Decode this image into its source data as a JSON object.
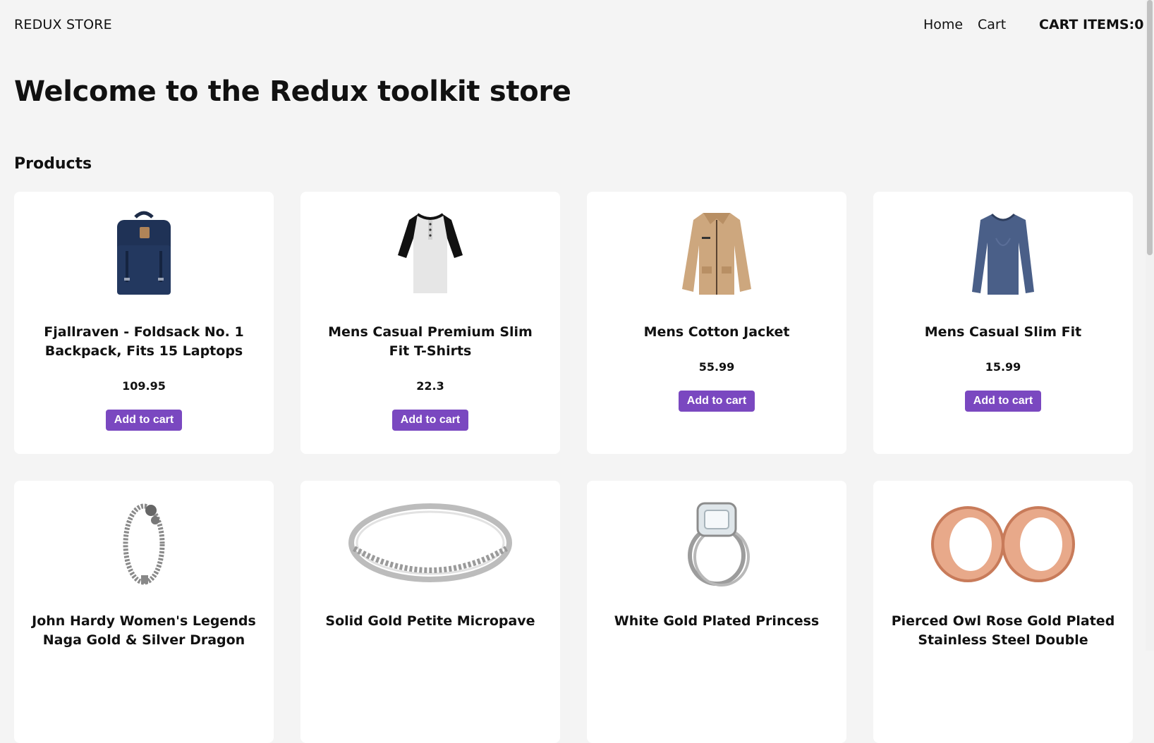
{
  "navbar": {
    "brand": "REDUX STORE",
    "links": [
      {
        "label": "Home"
      },
      {
        "label": "Cart"
      }
    ],
    "cart_items_label": "CART ITEMS:0"
  },
  "page": {
    "title": "Welcome to the Redux toolkit store",
    "section_title": "Products"
  },
  "products": [
    {
      "title": "Fjallraven - Foldsack No. 1 Backpack, Fits 15 Laptops",
      "price": "109.95",
      "button": "Add to cart",
      "icon": "backpack-icon"
    },
    {
      "title": "Mens Casual Premium Slim Fit T-Shirts",
      "price": "22.3",
      "button": "Add to cart",
      "icon": "tshirt-icon"
    },
    {
      "title": "Mens Cotton Jacket",
      "price": "55.99",
      "button": "Add to cart",
      "icon": "jacket-icon"
    },
    {
      "title": "Mens Casual Slim Fit",
      "price": "15.99",
      "button": "Add to cart",
      "icon": "longsleeve-shirt-icon"
    },
    {
      "title": "John Hardy Women's Legends Naga Gold & Silver Dragon",
      "icon": "bracelet-icon"
    },
    {
      "title": "Solid Gold Petite Micropave",
      "icon": "ring-icon"
    },
    {
      "title": "White Gold Plated Princess",
      "icon": "diamond-ring-icon"
    },
    {
      "title": "Pierced Owl Rose Gold Plated Stainless Steel Double",
      "icon": "ear-plugs-icon"
    }
  ],
  "colors": {
    "accent": "#7a48c0",
    "background": "#f4f4f4",
    "card": "#ffffff"
  }
}
